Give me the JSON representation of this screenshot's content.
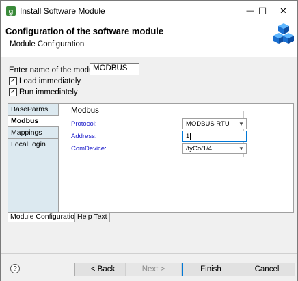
{
  "window": {
    "title": "Install Software Module",
    "minimize_glyph": "—",
    "maximize_glyph": "☐",
    "close_glyph": "✕"
  },
  "header": {
    "title": "Configuration of the software module",
    "subtitle": "Module Configuration"
  },
  "form": {
    "name_label": "Enter name of the module:",
    "name_value": "MODBUS",
    "load_label": "Load immediately",
    "load_checked": true,
    "run_label": "Run immediately",
    "run_checked": true
  },
  "vtabs": [
    {
      "label": "BaseParms",
      "active": false
    },
    {
      "label": "Modbus",
      "active": true
    },
    {
      "label": "Mappings",
      "active": false
    },
    {
      "label": "LocalLogin",
      "active": false
    }
  ],
  "modbus": {
    "group_title": "Modbus",
    "protocol_label": "Protocol:",
    "protocol_value": "MODBUS RTU",
    "address_label": "Address:",
    "address_value": "1",
    "comdevice_label": "ComDevice:",
    "comdevice_value": "/tyCo/1/4"
  },
  "bottom_tabs": [
    {
      "label": "Module Configuration",
      "active": true
    },
    {
      "label": "Help Text",
      "active": false
    }
  ],
  "footer": {
    "help_glyph": "?",
    "back_label": "< Back",
    "next_label": "Next >",
    "finish_label": "Finish",
    "cancel_label": "Cancel"
  },
  "colors": {
    "field_label": "#2222cc",
    "tab_panel": "#dce9f0",
    "focus_border": "#0078d7"
  }
}
